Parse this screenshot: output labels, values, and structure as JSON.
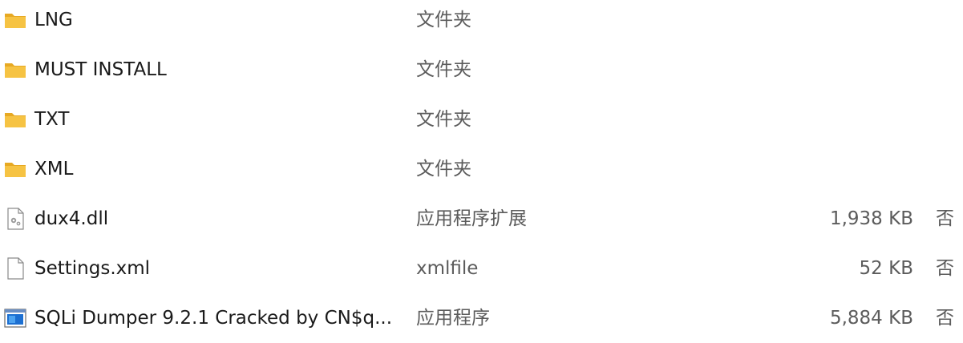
{
  "files": [
    {
      "name": "LNG",
      "type": "文件夹",
      "size": "",
      "extra": "",
      "icon": "folder-icon"
    },
    {
      "name": "MUST INSTALL",
      "type": "文件夹",
      "size": "",
      "extra": "",
      "icon": "folder-icon"
    },
    {
      "name": "TXT",
      "type": "文件夹",
      "size": "",
      "extra": "",
      "icon": "folder-icon"
    },
    {
      "name": "XML",
      "type": "文件夹",
      "size": "",
      "extra": "",
      "icon": "folder-icon"
    },
    {
      "name": "dux4.dll",
      "type": "应用程序扩展",
      "size": "1,938 KB",
      "extra": "否",
      "icon": "dll-file-icon"
    },
    {
      "name": "Settings.xml",
      "type": "xmlfile",
      "size": "52 KB",
      "extra": "否",
      "icon": "document-file-icon"
    },
    {
      "name": "SQLi Dumper 9.2.1 Cracked by CN$q...",
      "type": "应用程序",
      "size": "5,884 KB",
      "extra": "否",
      "icon": "application-icon"
    }
  ],
  "colors": {
    "folder": "#f6c343",
    "folder_dark": "#e7a923",
    "app_blue": "#1c6fd1"
  }
}
